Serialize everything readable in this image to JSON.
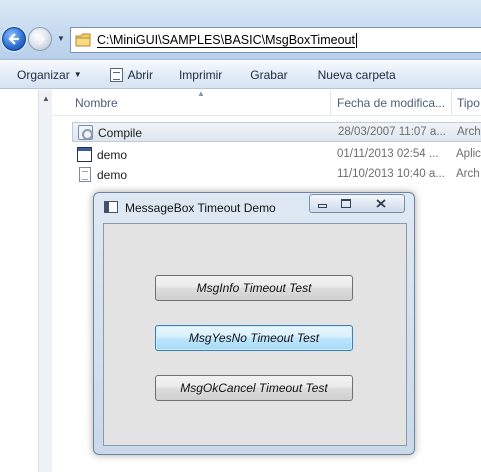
{
  "explorer": {
    "address": "C:\\MiniGUI\\SAMPLES\\BASIC\\MsgBoxTimeout",
    "toolbar": {
      "organize": "Organizar",
      "open": "Abrir",
      "print": "Imprimir",
      "burn": "Grabar",
      "new_folder": "Nueva carpeta"
    },
    "columns": {
      "name": "Nombre",
      "modified": "Fecha de modifica...",
      "type": "Tipo"
    },
    "files": [
      {
        "name": "Compile",
        "modified": "28/03/2007 11:07 a...",
        "type": "Arch",
        "icon": "settings-file-icon",
        "selected": true
      },
      {
        "name": "demo",
        "modified": "01/11/2013 02:54 ...",
        "type": "Aplic",
        "icon": "application-icon",
        "selected": false
      },
      {
        "name": "demo",
        "modified": "11/10/2013 10:40 a...",
        "type": "Arch",
        "icon": "text-file-icon",
        "selected": false
      }
    ]
  },
  "dialog": {
    "title": "MessageBox Timeout Demo",
    "buttons": [
      {
        "label": "MsgInfo Timeout Test",
        "focused": false
      },
      {
        "label": "MsgYesNo Timeout Test",
        "focused": true
      },
      {
        "label": "MsgOkCancel Timeout Test",
        "focused": false
      }
    ]
  },
  "colors": {
    "selection_border": "#c2cbd6",
    "focus_button": "#3c7fb1",
    "window_frame": "#6f83a0"
  }
}
